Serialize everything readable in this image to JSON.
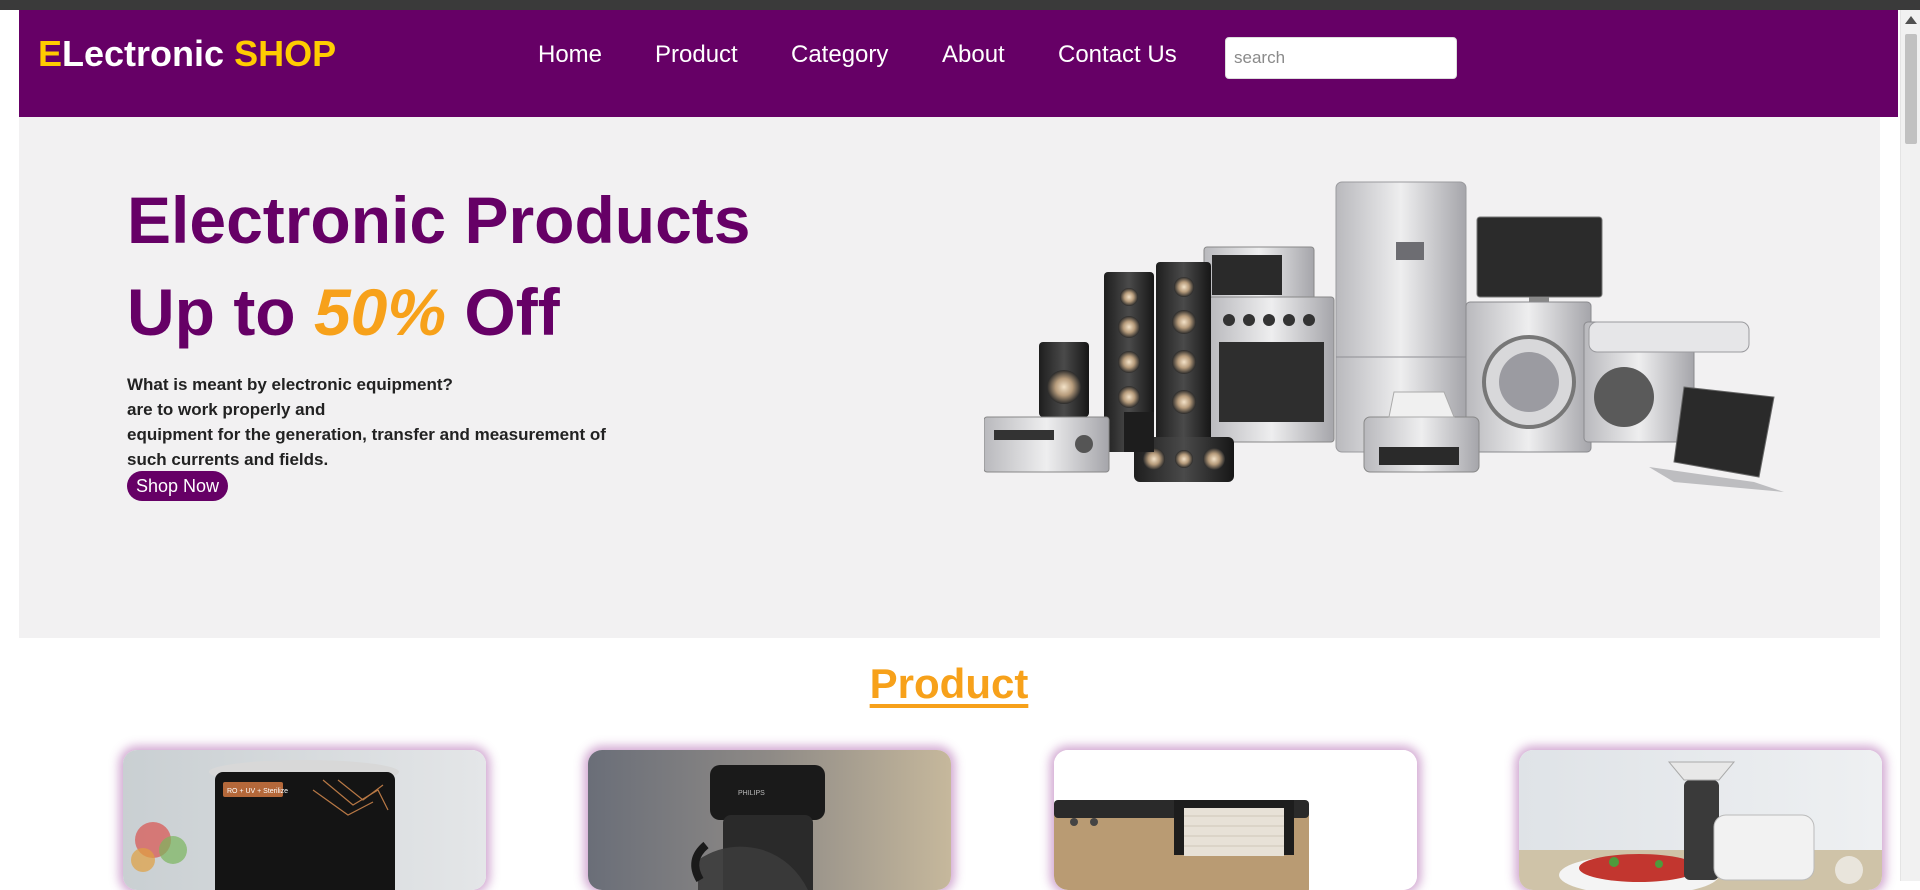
{
  "header": {
    "logo_first": "E",
    "logo_main": "Lectronic ",
    "logo_accent": "SHOP",
    "nav": [
      {
        "label": "Home"
      },
      {
        "label": "Product"
      },
      {
        "label": "Category"
      },
      {
        "label": "About"
      },
      {
        "label": "Contact Us"
      }
    ],
    "search": {
      "placeholder": "search",
      "value": ""
    }
  },
  "hero": {
    "title": "Electronic Products",
    "subtitle_prefix": "Up to ",
    "subtitle_highlight": "50%",
    "subtitle_suffix": " Off",
    "description_lines": [
      "What is meant by electronic equipment?",
      "are to work properly and",
      "equipment for the generation, transfer and measurement of",
      "such currents and fields."
    ],
    "cta_label": "Shop Now",
    "image": "home-appliances-collage"
  },
  "products": {
    "heading": "Product",
    "cards": [
      {
        "image": "water-purifier",
        "badge": "RO + UV + Sterilize"
      },
      {
        "image": "coffee-maker",
        "badge": "PHILIPS"
      },
      {
        "image": "towel-warmer"
      },
      {
        "image": "meat-grinder"
      }
    ]
  },
  "colors": {
    "brand_purple": "#660066",
    "accent_yellow": "#ffcc00",
    "accent_orange": "#f7a11a",
    "hero_bg": "#f2f1f2"
  }
}
